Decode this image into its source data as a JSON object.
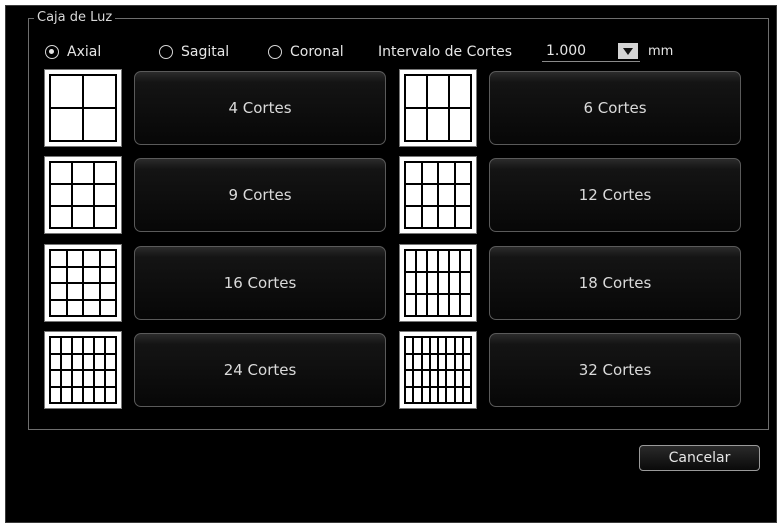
{
  "group_title": "Caja de Luz",
  "orientation": {
    "options": [
      {
        "label": "Axial",
        "selected": true
      },
      {
        "label": "Sagital",
        "selected": false
      },
      {
        "label": "Coronal",
        "selected": false
      }
    ]
  },
  "interval": {
    "label": "Intervalo de Cortes",
    "value": "1.000",
    "unit": "mm"
  },
  "layouts": [
    {
      "label": "4 Cortes",
      "icon": "grid-2x2-icon",
      "cols": 2,
      "rows": 2
    },
    {
      "label": "6 Cortes",
      "icon": "grid-3x2-icon",
      "cols": 3,
      "rows": 2
    },
    {
      "label": "9 Cortes",
      "icon": "grid-3x3-icon",
      "cols": 3,
      "rows": 3
    },
    {
      "label": "12 Cortes",
      "icon": "grid-4x3-icon",
      "cols": 4,
      "rows": 3
    },
    {
      "label": "16 Cortes",
      "icon": "grid-4x4-icon",
      "cols": 4,
      "rows": 4
    },
    {
      "label": "18 Cortes",
      "icon": "grid-6x3-icon",
      "cols": 6,
      "rows": 3
    },
    {
      "label": "24 Cortes",
      "icon": "grid-6x4-icon",
      "cols": 6,
      "rows": 4
    },
    {
      "label": "32 Cortes",
      "icon": "grid-8x4-icon",
      "cols": 8,
      "rows": 4
    }
  ],
  "cancel_label": "Cancelar"
}
